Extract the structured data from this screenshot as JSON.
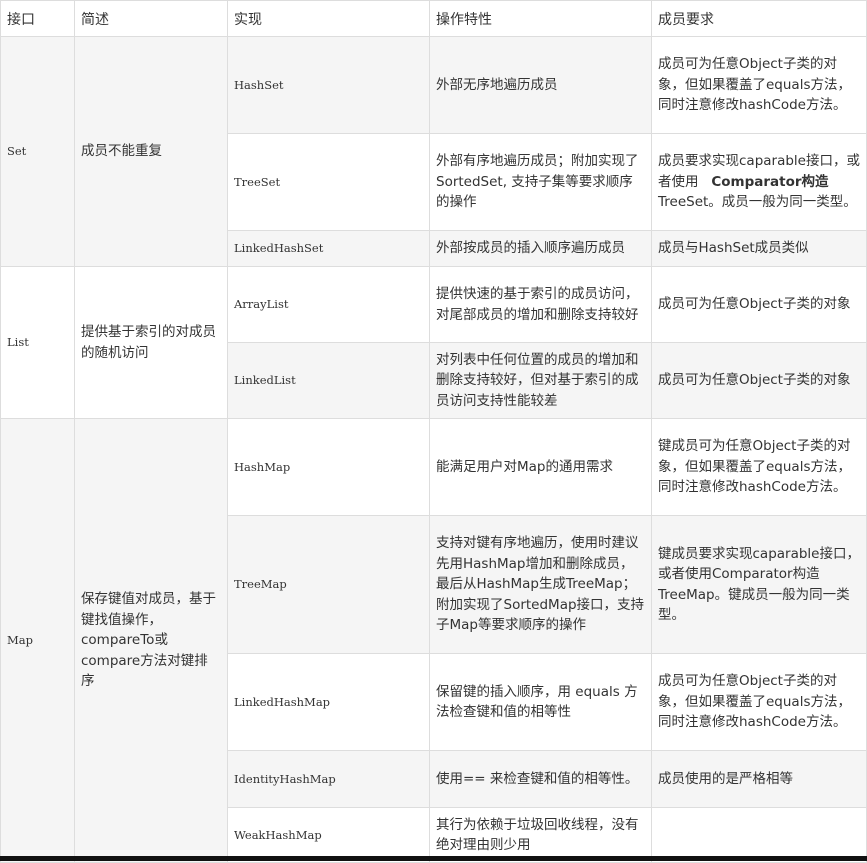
{
  "headers": [
    "接口",
    "简述",
    "实现",
    "操作特性",
    "成员要求"
  ],
  "groups": [
    {
      "interface": "Set",
      "summary": "成员不能重复",
      "rows": [
        {
          "impl": "HashSet",
          "feature": "外部无序地遍历成员",
          "requirement": "成员可为任意Object子类的对象，但如果覆盖了equals方法，同时注意修改hashCode方法。"
        },
        {
          "impl": "TreeSet",
          "feature": "外部有序地遍历成员；附加实现了SortedSet, 支持子集等要求顺序的操作",
          "requirement_pre": "成员要求实现caparable接口，或者使用",
          "requirement_bold": "Comparator构造",
          "requirement_post": "TreeSet。成员一般为同一类型。"
        },
        {
          "impl": "LinkedHashSet",
          "feature": "外部按成员的插入顺序遍历成员",
          "requirement": "成员与HashSet成员类似"
        }
      ]
    },
    {
      "interface": "List",
      "summary": "提供基于索引的对成员的随机访问",
      "rows": [
        {
          "impl": "ArrayList",
          "feature": "提供快速的基于索引的成员访问，对尾部成员的增加和删除支持较好",
          "requirement": "成员可为任意Object子类的对象"
        },
        {
          "impl": "LinkedList",
          "feature": "对列表中任何位置的成员的增加和删除支持较好，但对基于索引的成员访问支持性能较差",
          "requirement": "成员可为任意Object子类的对象"
        }
      ]
    },
    {
      "interface": "Map",
      "summary": "保存键值对成员，基于键找值操作，compareTo或compare方法对键排序",
      "rows": [
        {
          "impl": "HashMap",
          "feature": "能满足用户对Map的通用需求",
          "requirement": "键成员可为任意Object子类的对象，但如果覆盖了equals方法，同时注意修改hashCode方法。"
        },
        {
          "impl": "TreeMap",
          "feature": "支持对键有序地遍历，使用时建议先用HashMap增加和删除成员，最后从HashMap生成TreeMap；附加实现了SortedMap接口，支持子Map等要求顺序的操作",
          "requirement": "键成员要求实现caparable接口，或者使用Comparator构造TreeMap。键成员一般为同一类型。"
        },
        {
          "impl": "LinkedHashMap",
          "feature": "保留键的插入顺序，用 equals 方法检查键和值的相等性",
          "requirement": "成员可为任意Object子类的对象，但如果覆盖了equals方法，同时注意修改hashCode方法。"
        },
        {
          "impl": "IdentityHashMap",
          "feature": "使用== 来检查键和值的相等性。",
          "requirement": "成员使用的是严格相等"
        },
        {
          "impl": "WeakHashMap",
          "feature": "其行为依赖于垃圾回收线程，没有绝对理由则少用",
          "requirement": ""
        }
      ]
    }
  ]
}
